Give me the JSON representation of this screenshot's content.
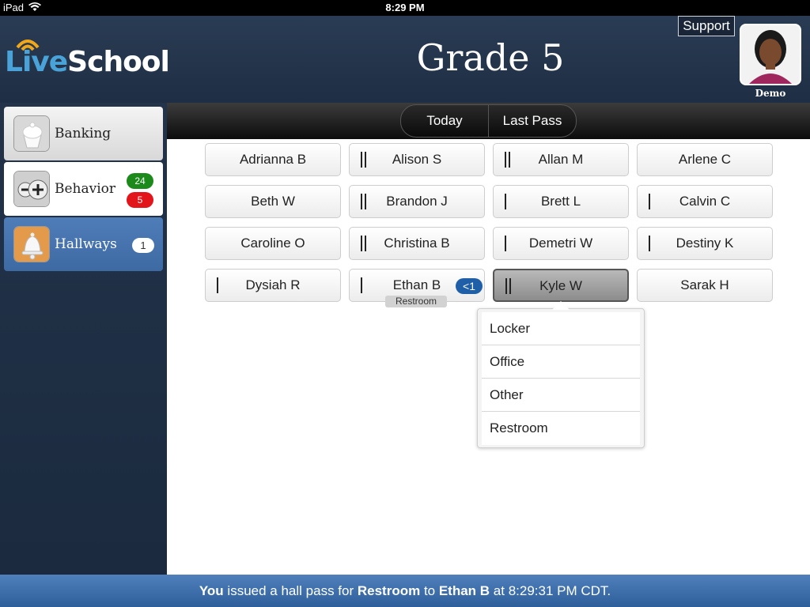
{
  "status_bar": {
    "device": "iPad",
    "time": "8:29 PM"
  },
  "header": {
    "logo": {
      "live": "Live",
      "school": "School"
    },
    "title": "Grade 5",
    "support_label": "Support",
    "user_name": "Demo"
  },
  "sidebar": {
    "items": [
      {
        "label": "Banking",
        "icon": "cupcake-icon"
      },
      {
        "label": "Behavior",
        "icon": "plus-minus-icon",
        "positive_count": "24",
        "negative_count": "5"
      },
      {
        "label": "Hallways",
        "icon": "bell-icon",
        "count": "1",
        "active": true
      }
    ]
  },
  "toolbar": {
    "tabs": [
      "Today",
      "Last Pass"
    ]
  },
  "students": [
    {
      "name": "Adrianna B",
      "tally": 0
    },
    {
      "name": "Alison S",
      "tally": 2
    },
    {
      "name": "Allan M",
      "tally": 2
    },
    {
      "name": "Arlene C",
      "tally": 0
    },
    {
      "name": "Beth W",
      "tally": 0
    },
    {
      "name": "Brandon J",
      "tally": 2
    },
    {
      "name": "Brett L",
      "tally": 1
    },
    {
      "name": "Calvin C",
      "tally": 1
    },
    {
      "name": "Caroline O",
      "tally": 0
    },
    {
      "name": "Christina B",
      "tally": 2
    },
    {
      "name": "Demetri W",
      "tally": 1
    },
    {
      "name": "Destiny K",
      "tally": 1
    },
    {
      "name": "Dysiah R",
      "tally": 1
    },
    {
      "name": "Ethan B",
      "tally": 1,
      "time": "<1",
      "status": "Restroom"
    },
    {
      "name": "Kyle W",
      "tally": 2,
      "selected": true
    },
    {
      "name": "Sarak H",
      "tally": 0
    }
  ],
  "popover": {
    "options": [
      "Locker",
      "Office",
      "Other",
      "Restroom"
    ]
  },
  "notification": {
    "actor": "You",
    "t1": " issued a hall pass for ",
    "pass_type": "Restroom",
    "t2": " to ",
    "student": "Ethan B",
    "t3": " at 8:29:31 PM CDT."
  },
  "colors": {
    "accent_blue": "#1f5fa8",
    "positive": "#1b8a1b",
    "negative": "#e2151b"
  }
}
